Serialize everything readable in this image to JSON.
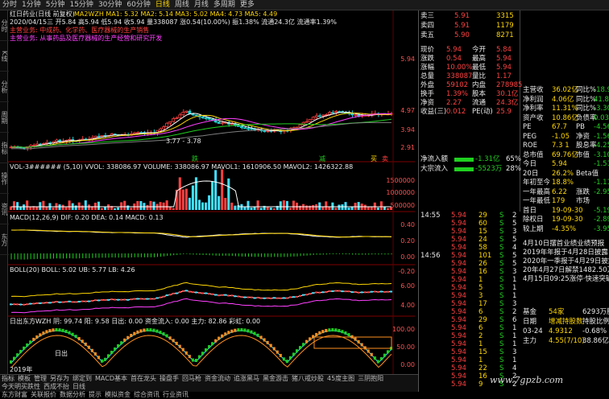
{
  "topbar": {
    "items": [
      "分时",
      "1分钟",
      "5分钟",
      "15分钟",
      "30分钟",
      "60分钟",
      "日线",
      "周线",
      "月线",
      "多周期",
      "更多"
    ],
    "active": 6
  },
  "lefttabs": [
    "分时",
    "K线",
    "分析",
    "周期",
    "指标",
    "操作",
    "资讯",
    "东方"
  ],
  "main": {
    "title": "红日药业(日线 前复权)",
    "ma_line": "MA2WZH MA1: 5.32  MA2: 5.14  MA3: 5.02  MA4: 4.73  MA5: 4.49",
    "date_line": "2020/04/15三 开5.84 高5.94 低5.94 收5.94 量338087 涨0.54(10.00%) 振1.38% 流通24.3亿 流通率1.39%",
    "news1": "主营业务: 中成药、化学药、医疗器械的生产销售",
    "news2": "主营业务: 从事药品及医疗器械的生产经营和研究开发",
    "axis": [
      "5.94",
      "4.97",
      "3.94",
      "2.91"
    ],
    "marks": {
      "a": "3.77 - 3.78",
      "b": "跌",
      "c": "减",
      "d": "买",
      "e": "卖"
    }
  },
  "vol": {
    "line": "VOL-3###### (5,10)  VVOL: 338086.97  VOLUME: 338086.97  MAVOL1: 1610906.50  MAVOL2: 1426322.88",
    "axis": [
      "1500000",
      "1000000",
      "500000"
    ]
  },
  "macd": {
    "line": "MACD(12,26,9)  DIF: 0.20  DEA: 0.14  MACD: 0.13",
    "axis": [
      "0.40",
      "0.20",
      "0.00",
      "-0.20"
    ]
  },
  "boll": {
    "line": "BOLL(20)  BOLL: 5.02  UB: 5.77  LB: 4.26",
    "axis": [
      "6.00",
      "4.00"
    ]
  },
  "wzh": {
    "line": "日出东方WZH  阴: 99.74  阳: 9.58  日出: 0.00  资金流入: 0.00  主力: 82.86  彩虹: 0.00",
    "axis": [
      "100.00",
      "50.00",
      "0.00"
    ],
    "mark": "日出"
  },
  "year": "2019年",
  "bottomtabs": [
    "指标",
    "模板",
    "管理",
    "另存为",
    "绑定到",
    "MACD基本",
    "首在龙头",
    "操盘手",
    "回马枪",
    "资金流动",
    "追涨黑马",
    "黑金游击",
    "猪八戒炒股",
    "45度主图",
    "三阴抱阳",
    "今天明买跌性",
    "西成不抬",
    "日线"
  ],
  "bottomtabs2": [
    "东方财富",
    "关联报价",
    "数据分析",
    "提示",
    "模拟资金",
    "综合资讯",
    "行业资讯"
  ],
  "book": {
    "rows": [
      {
        "label": "卖三",
        "price": "5.91",
        "vol": "3315"
      },
      {
        "label": "卖四",
        "price": "5.91",
        "vol": "1179"
      },
      {
        "label": "卖五",
        "price": "5.90",
        "vol": "8271"
      }
    ],
    "stats": [
      {
        "k1": "现价",
        "v1": "5.94",
        "k2": "今开",
        "v2": "5.84"
      },
      {
        "k1": "涨跌",
        "v1": "0.54",
        "k2": "最高",
        "v2": "5.94"
      },
      {
        "k1": "涨幅",
        "v1": "10.00%",
        "k2": "最低",
        "v2": "5.94"
      },
      {
        "k1": "总量",
        "v1": "338087",
        "k2": "量比",
        "v2": "1.17"
      },
      {
        "k1": "外盘",
        "v1": "59102",
        "k2": "内盘",
        "v2": "278985"
      },
      {
        "k1": "换手",
        "v1": "1.39%",
        "k2": "股本",
        "v2": "30.1亿"
      },
      {
        "k1": "净资",
        "v1": "2.27",
        "k2": "流通",
        "v2": "24.3亿"
      },
      {
        "k1": "收益(三)",
        "v1": "0.012",
        "k2": "PE(动)",
        "v2": "25.9"
      }
    ],
    "flow": [
      {
        "k": "净流入额",
        "v": "-1.31亿",
        "p": "65%"
      },
      {
        "k": "大宗流入",
        "v": "-5523万",
        "p": "28%"
      }
    ]
  },
  "ticks": [
    {
      "t": "14:55",
      "p": "5.94",
      "v": "29",
      "f": "S",
      "n": "2"
    },
    {
      "t": "",
      "p": "5.94",
      "v": "60",
      "f": "S",
      "n": "5"
    },
    {
      "t": "",
      "p": "5.94",
      "v": "15",
      "f": "S",
      "n": "3"
    },
    {
      "t": "",
      "p": "5.94",
      "v": "24",
      "f": "S",
      "n": "5"
    },
    {
      "t": "",
      "p": "5.94",
      "v": "58",
      "f": "S",
      "n": "4"
    },
    {
      "t": "14:56",
      "p": "5.94",
      "v": "101",
      "f": "S",
      "n": "5"
    },
    {
      "t": "",
      "p": "5.94",
      "v": "26",
      "f": "S",
      "n": "5"
    },
    {
      "t": "",
      "p": "5.94",
      "v": "16",
      "f": "S",
      "n": "3"
    },
    {
      "t": "",
      "p": "5.94",
      "v": "1",
      "f": "S",
      "n": "1"
    },
    {
      "t": "",
      "p": "5.94",
      "v": "5",
      "f": "S",
      "n": "1"
    },
    {
      "t": "",
      "p": "5.94",
      "v": "3",
      "f": "S",
      "n": "1"
    },
    {
      "t": "",
      "p": "5.94",
      "v": "17",
      "f": "S",
      "n": "3"
    },
    {
      "t": "",
      "p": "5.94",
      "v": "6",
      "f": "S",
      "n": "2"
    },
    {
      "t": "",
      "p": "5.94",
      "v": "29",
      "f": "S",
      "n": "6"
    },
    {
      "t": "",
      "p": "5.94",
      "v": "6",
      "f": "S",
      "n": "1"
    },
    {
      "t": "",
      "p": "5.94",
      "v": "2",
      "f": "S",
      "n": "1"
    },
    {
      "t": "",
      "p": "5.94",
      "v": "1",
      "f": "S",
      "n": "1"
    },
    {
      "t": "",
      "p": "5.94",
      "v": "15",
      "f": "S",
      "n": "3"
    },
    {
      "t": "",
      "p": "5.94",
      "v": "1",
      "f": "S",
      "n": "1"
    },
    {
      "t": "",
      "p": "5.94",
      "v": "22",
      "f": "S",
      "n": "4"
    },
    {
      "t": "",
      "p": "5.94",
      "v": "16",
      "f": "S",
      "n": "2"
    },
    {
      "t": "",
      "p": "5.94",
      "v": "9",
      "f": "S",
      "n": "2"
    }
  ],
  "fund": [
    {
      "k": "主营收",
      "v": "36.02亿",
      "k2": "同比%",
      "v2": "-18.95"
    },
    {
      "k": "净利润",
      "v": "4.06亿",
      "k2": "同比%",
      "v2": "41.85"
    },
    {
      "k": "净利率",
      "v": "11.31%",
      "k2": "同比%",
      "v2": "-3.30"
    },
    {
      "k": "资产收",
      "v": "10.86亿",
      "k2": "负债率",
      "v2": "0.03"
    },
    {
      "k": "PE",
      "v": "67.7",
      "k2": "PB",
      "v2": "-4.56"
    },
    {
      "k": "PEG",
      "v": "-1.05",
      "k2": "净资",
      "v2": "-1.56"
    },
    {
      "k": "ROE",
      "v": "7.3 1",
      "k2": "股息率",
      "v2": "-4.25"
    },
    {
      "k": "总市值",
      "v": "69.76亿",
      "k2": "市值",
      "v2": "-3.10"
    },
    {
      "k": "今日",
      "v": "5.94",
      "k2": "",
      "v2": "-1.51"
    },
    {
      "k": "20日",
      "v": "26.2%",
      "k2": "Beta值",
      "v2": ""
    },
    {
      "k": "年初至今",
      "v": "18.8%",
      "k2": "",
      "v2": "-1.11"
    },
    {
      "k": "一年最高",
      "v": "6.22",
      "k2": "涨跌",
      "v2": "-2.95"
    },
    {
      "k": "一年最低",
      "v": "179",
      "k2": "市场",
      "v2": ""
    },
    {
      "k": "首日",
      "v": "19-09-30",
      "k2": "",
      "v2": "-5.19"
    },
    {
      "k": "除权日",
      "v": "19-09-30",
      "k2": "",
      "v2": "-2.89"
    },
    {
      "k": "较上期",
      "v": "-4.35%",
      "k2": "",
      "v2": "-3.95"
    }
  ],
  "news": [
    "4月10日摆首业绩业绩预报",
    "2019年年报于4月28日披露",
    "2020年一季报于4月29日披露",
    "20年4月27日解禁1482.50万股",
    "4月15日09:25涨停·快速突破"
  ],
  "fund2": [
    {
      "k": "基金",
      "v": "54家",
      "k2": "6293万股",
      "v2": "万股"
    },
    {
      "k": "日期",
      "v": "增减持股数",
      "k2": "持股比例",
      "v2": ""
    },
    {
      "k": "03-24",
      "v": "4.9312",
      "k2": "-0.68%",
      "v2": ""
    },
    {
      "k": "主力",
      "v": "4.55(7/10)",
      "k2": "38.86亿",
      "v2": ""
    }
  ],
  "watermark": "www.7gpzb.com",
  "colors": {
    "up": "#ff4040",
    "down": "#20d020",
    "ma1": "#ffffff",
    "ma2": "#ffd700",
    "ma3": "#ff40ff",
    "ma4": "#20d020",
    "ma5": "#808080"
  }
}
